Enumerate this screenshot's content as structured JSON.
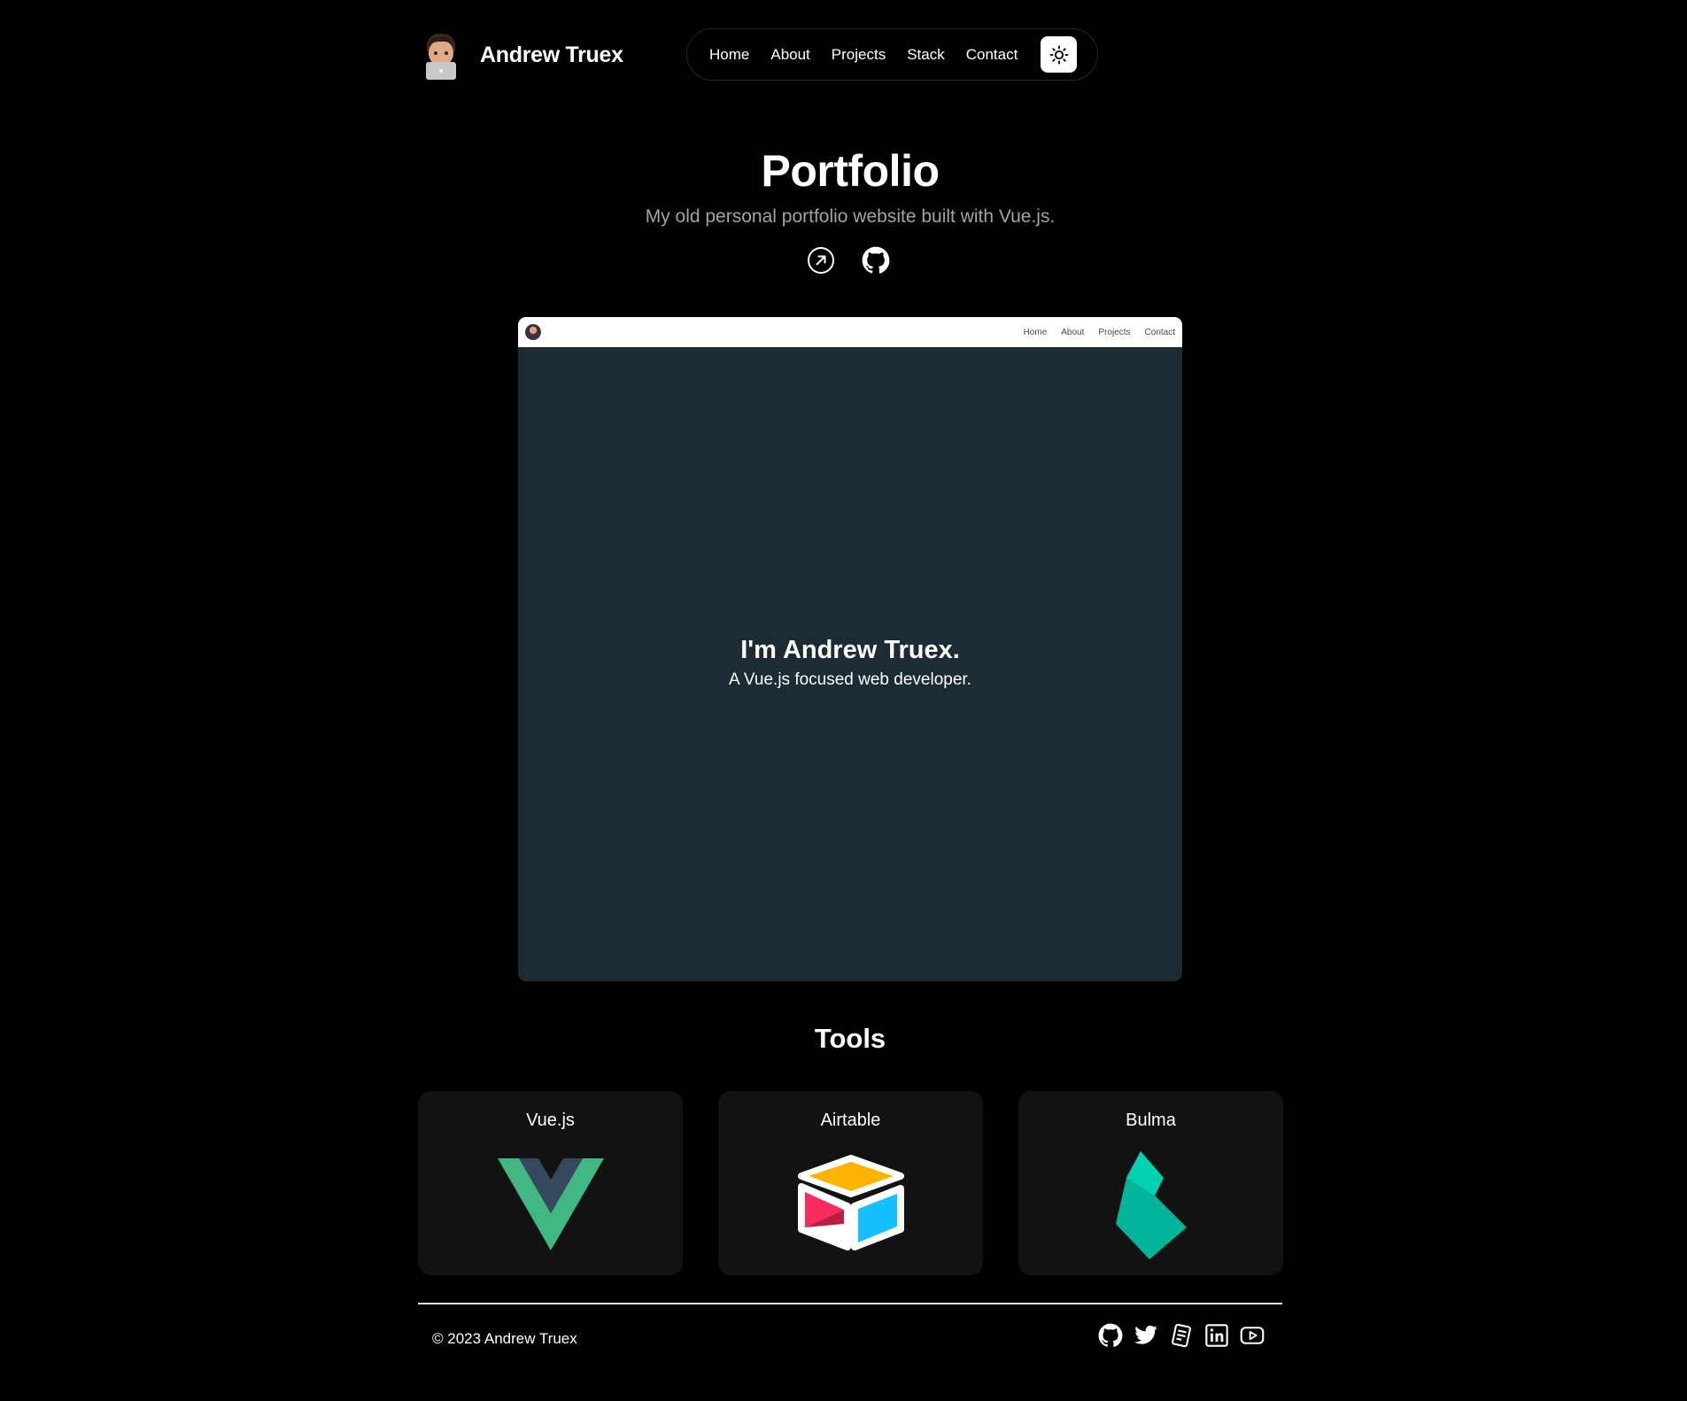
{
  "header": {
    "brand_name": "Andrew Truex",
    "nav": [
      "Home",
      "About",
      "Projects",
      "Stack",
      "Contact"
    ]
  },
  "hero": {
    "title": "Portfolio",
    "subtitle": "My old personal portfolio website built with Vue.js."
  },
  "preview": {
    "nav": [
      "Home",
      "About",
      "Projects",
      "Contact"
    ],
    "heading": "I'm Andrew Truex.",
    "subheading": "A Vue.js focused web developer."
  },
  "tools": {
    "title": "Tools",
    "items": [
      {
        "name": "Vue.js",
        "icon": "vue-logo-icon"
      },
      {
        "name": "Airtable",
        "icon": "airtable-logo-icon"
      },
      {
        "name": "Bulma",
        "icon": "bulma-logo-icon"
      }
    ]
  },
  "footer": {
    "copyright": "© 2023 Andrew Truex",
    "socials": [
      "github-icon",
      "twitter-icon",
      "blog-icon",
      "linkedin-icon",
      "youtube-icon"
    ]
  },
  "colors": {
    "background": "#000000",
    "card": "#111212",
    "preview_bg": "#1d2b33",
    "muted_text": "#a3a3a3"
  }
}
